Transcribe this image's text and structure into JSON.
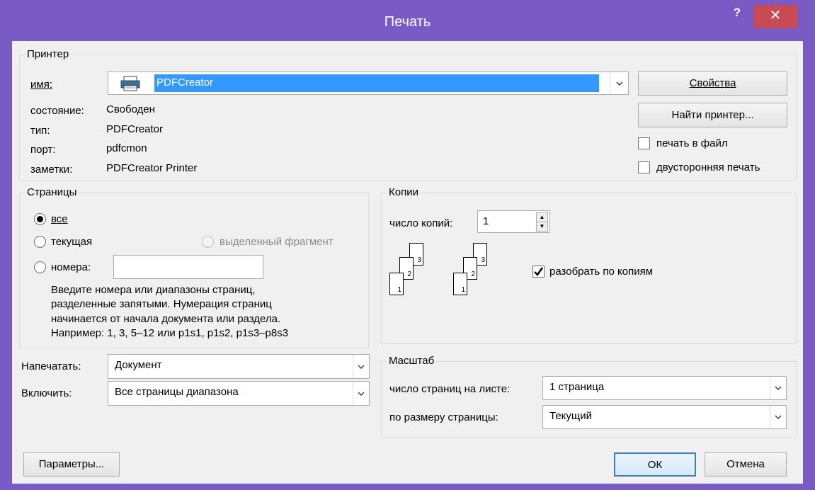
{
  "window": {
    "title": "Печать",
    "help": "?",
    "close": "✕"
  },
  "printer": {
    "legend": "Принтер",
    "name_label": "имя:",
    "name_value": "PDFCreator",
    "status_label": "состояние:",
    "status_value": "Свободен",
    "type_label": "тип:",
    "type_value": "PDFCreator",
    "port_label": "порт:",
    "port_value": "pdfcmon",
    "notes_label": "заметки:",
    "notes_value": "PDFCreator Printer",
    "properties_button": "Свойства",
    "find_button": "Найти принтер...",
    "print_to_file": "печать в файл",
    "duplex": "двусторонняя печать"
  },
  "pages": {
    "legend": "Страницы",
    "all": "все",
    "current": "текущая",
    "selection": "выделенный фрагмент",
    "numbers": "номера:",
    "numbers_value": "",
    "hint_lines": [
      "Введите номера или диапазоны страниц,",
      "разделенные запятыми. Нумерация страниц",
      "начинается от начала документа или раздела.",
      "Например: 1, 3, 5–12 или p1s1, p1s2, p1s3–p8s3"
    ]
  },
  "copies": {
    "legend": "Копии",
    "count_label": "число копий:",
    "count_value": "1",
    "collate_label": "разобрать по копиям",
    "collate_checked": true,
    "page_numbers": [
      "3",
      "2",
      "1"
    ]
  },
  "print_what": {
    "label": "Напечатать:",
    "value": "Документ"
  },
  "include": {
    "label": "Включить:",
    "value": "Все страницы диапазона"
  },
  "zoom": {
    "legend": "Масштаб",
    "pages_per_sheet_label": "число страниц на листе:",
    "pages_per_sheet_value": "1 страница",
    "scale_label": "по размеру страницы:",
    "scale_value": "Текущий"
  },
  "footer": {
    "options": "Параметры...",
    "ok": "ОК",
    "cancel": "Отмена"
  },
  "colors": {
    "frame": "#7a5bc6",
    "close": "#c74a54",
    "selection": "#3399ff"
  }
}
